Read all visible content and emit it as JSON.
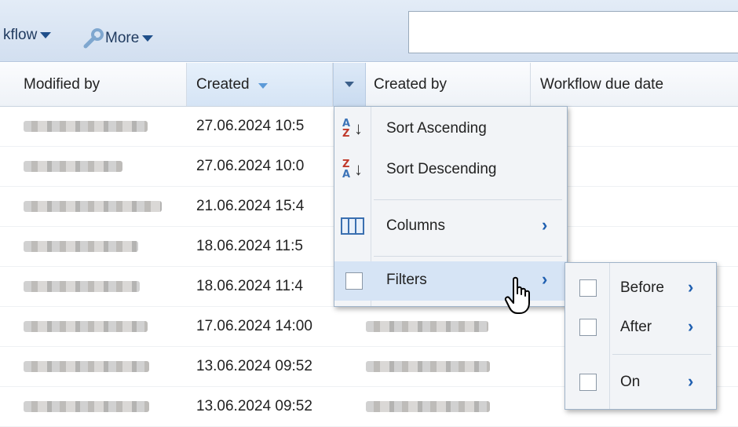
{
  "toolbar": {
    "workflow_label": "kflow",
    "more_label": "More"
  },
  "columns": {
    "modified_by": "Modified by",
    "created": "Created",
    "created_by": "Created by",
    "workflow_due_date": "Workflow due date"
  },
  "rows": [
    {
      "created": "27.06.2024 10:5"
    },
    {
      "created": "27.06.2024 10:0"
    },
    {
      "created": "21.06.2024 15:4"
    },
    {
      "created": "18.06.2024 11:5"
    },
    {
      "created": "18.06.2024 11:4"
    },
    {
      "created": "17.06.2024 14:00"
    },
    {
      "created": "13.06.2024 09:52"
    },
    {
      "created": "13.06.2024 09:52"
    }
  ],
  "column_menu": {
    "sort_ascending": "Sort Ascending",
    "sort_descending": "Sort Descending",
    "columns": "Columns",
    "filters": "Filters"
  },
  "filter_menu": {
    "before": "Before",
    "after": "After",
    "on": "On"
  },
  "icons": {
    "sort_asc_top": "A",
    "sort_asc_bottom": "Z",
    "sort_desc_top": "Z",
    "sort_desc_bottom": "A"
  }
}
